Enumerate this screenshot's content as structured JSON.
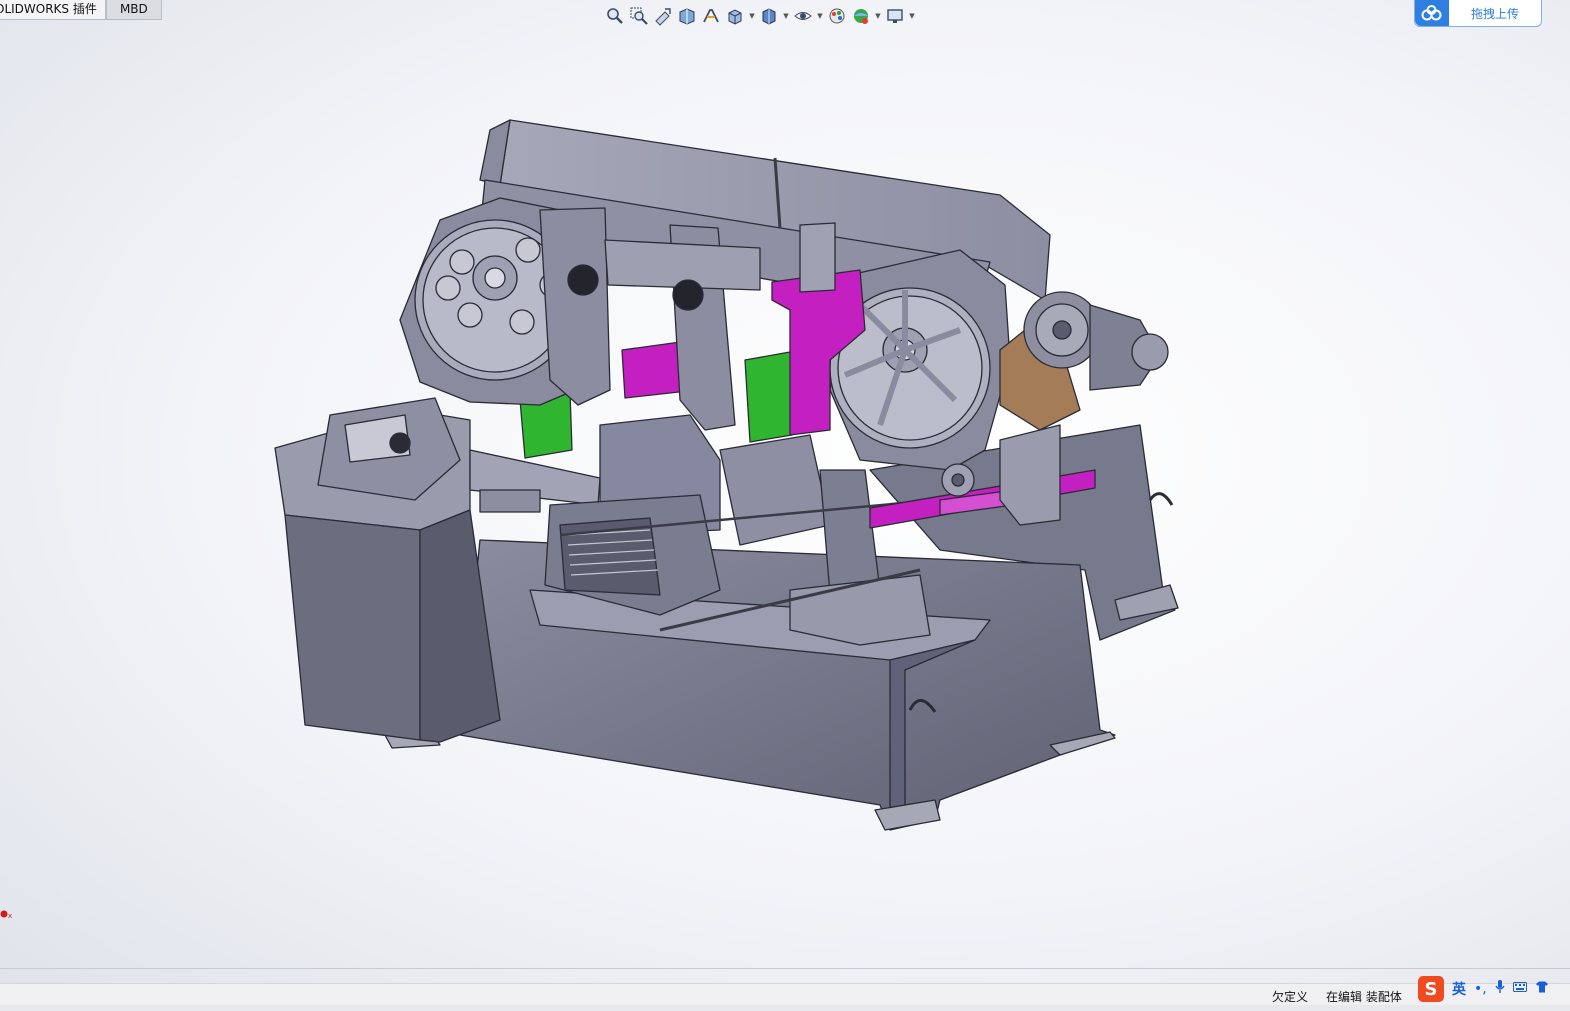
{
  "tabs": [
    {
      "label": "OLIDWORKS 插件"
    },
    {
      "label": "MBD"
    }
  ],
  "hud_toolbar": {
    "icons": [
      "zoom-to-fit-icon",
      "zoom-area-icon",
      "previous-view-icon",
      "section-view-icon",
      "dynamic-annotation-icon",
      "view-orientation-icon",
      "display-style-icon",
      "hide-show-icon",
      "edit-appearance-icon",
      "apply-scene-icon",
      "view-settings-icon"
    ]
  },
  "upload": {
    "label": "拖拽上传"
  },
  "status": {
    "under_defined": "欠定义",
    "editing": "在编辑 装配体"
  },
  "ime": {
    "logo": "S",
    "lang": "英",
    "dots": "•,",
    "mic": "🎤",
    "keyboard": "⌨",
    "shirt": "👕"
  },
  "colors": {
    "machine_body": "#6f7184",
    "machine_light": "#9a9bac",
    "magenta": "#c41fc1",
    "green": "#2fb52f",
    "bronze": "#a47c58",
    "accent_blue": "#2e7fe0"
  }
}
